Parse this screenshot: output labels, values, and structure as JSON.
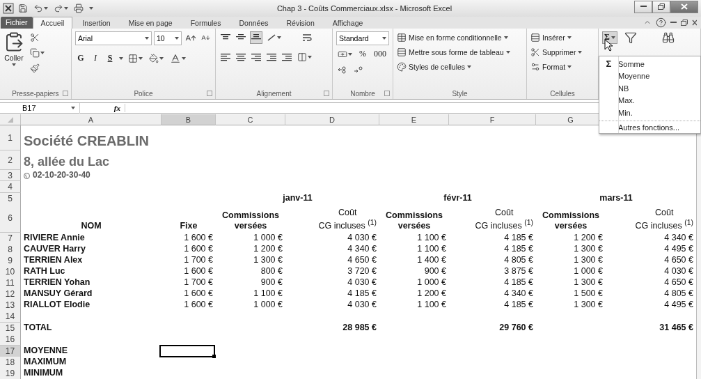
{
  "window": {
    "title": "Chap 3 - Coûts Commerciaux.xlsx - Microsoft Excel"
  },
  "ribbon": {
    "file_tab": "Fichier",
    "tabs": [
      {
        "label": "Accueil",
        "selected": true
      },
      {
        "label": "Insertion",
        "selected": false
      },
      {
        "label": "Mise en page",
        "selected": false
      },
      {
        "label": "Formules",
        "selected": false
      },
      {
        "label": "Données",
        "selected": false
      },
      {
        "label": "Révision",
        "selected": false
      },
      {
        "label": "Affichage",
        "selected": false
      }
    ],
    "groups": [
      {
        "kind": "clipboard",
        "label": "Presse-papiers",
        "launcher": true,
        "paste": "Coller"
      },
      {
        "kind": "font",
        "label": "Police",
        "launcher": true,
        "font": "Arial",
        "size": "10",
        "bold": "G",
        "italic": "I",
        "underline": "S"
      },
      {
        "kind": "alignment",
        "label": "Alignement",
        "launcher": true
      },
      {
        "kind": "number",
        "label": "Nombre",
        "launcher": true,
        "format": "Standard",
        "percent": "%",
        "thousands": "000"
      },
      {
        "kind": "style",
        "label": "Style",
        "items": [
          "Mise en forme conditionnelle",
          "Mettre sous forme de tableau",
          "Styles de cellules"
        ]
      },
      {
        "kind": "cells",
        "label": "Cellules",
        "items": [
          "Insérer",
          "Supprimer",
          "Format"
        ]
      },
      {
        "kind": "editing",
        "sum": "Σ",
        "pressed": true
      }
    ]
  },
  "formula_bar": {
    "name_box": "B17",
    "fx": "fx"
  },
  "sheet": {
    "columns": [
      {
        "label": "A",
        "selected": false
      },
      {
        "label": "B",
        "selected": true
      },
      {
        "label": "C",
        "selected": false
      },
      {
        "label": "D",
        "selected": false
      },
      {
        "label": "E",
        "selected": false
      },
      {
        "label": "F",
        "selected": false
      },
      {
        "label": "G",
        "selected": false
      }
    ],
    "rows": [
      {
        "header": "1",
        "selected": false,
        "kind": "company",
        "text": "Société CREABLIN"
      },
      {
        "header": "2",
        "selected": false,
        "kind": "address",
        "text": "8, allée du Lac"
      },
      {
        "header": "3",
        "selected": false,
        "kind": "phone",
        "text": "02-10-20-30-40"
      },
      {
        "header": "4",
        "selected": false,
        "kind": "blank"
      },
      {
        "header": "5",
        "selected": false,
        "kind": "months",
        "months": [
          "janv-11",
          "févr-11",
          "mars-11"
        ]
      },
      {
        "header": "6",
        "selected": false,
        "kind": "headings",
        "name": "NOM",
        "fixed": "Fixe",
        "groups": [
          {
            "commissions": "Commissions\nversées",
            "cost": "Coût\nCG incluses $^{(1)}$"
          },
          {
            "commissions": "Commissions\nversées",
            "cost": "Coût\nCG incluses $^{(1)}$"
          },
          {
            "commissions": "Commissions\nversées",
            "cost": "Coût\nCG incluses $^{(1)}$"
          }
        ]
      },
      {
        "header": "7",
        "selected": false,
        "kind": "person",
        "name": "RIVIERE Annie",
        "fixed": "1 600 €",
        "values": [
          "1 000 €",
          "4 030 €",
          "1 100 €",
          "4 185 €",
          "1 200 €",
          "4 340 €"
        ]
      },
      {
        "header": "8",
        "selected": false,
        "kind": "person",
        "name": "CAUVER Harry",
        "fixed": "1 600 €",
        "values": [
          "1 200 €",
          "4 340 €",
          "1 100 €",
          "4 185 €",
          "1 300 €",
          "4 495 €"
        ]
      },
      {
        "header": "9",
        "selected": false,
        "kind": "person",
        "name": "TERRIEN Alex",
        "fixed": "1 700 €",
        "values": [
          "1 300 €",
          "4 650 €",
          "1 400 €",
          "4 805 €",
          "1 300 €",
          "4 650 €"
        ]
      },
      {
        "header": "10",
        "selected": false,
        "kind": "person",
        "name": "RATH Luc",
        "fixed": "1 600 €",
        "values": [
          "800 €",
          "3 720 €",
          "900 €",
          "3 875 €",
          "1 000 €",
          "4 030 €"
        ]
      },
      {
        "header": "11",
        "selected": false,
        "kind": "person",
        "name": "TERRIEN Yohan",
        "fixed": "1 700 €",
        "values": [
          "900 €",
          "4 030 €",
          "1 000 €",
          "4 185 €",
          "1 300 €",
          "4 650 €"
        ]
      },
      {
        "header": "12",
        "selected": false,
        "kind": "person",
        "name": "MANSUY Gérard",
        "fixed": "1 600 €",
        "values": [
          "1 100 €",
          "4 185 €",
          "1 200 €",
          "4 340 €",
          "1 500 €",
          "4 805 €"
        ]
      },
      {
        "header": "13",
        "selected": false,
        "kind": "person",
        "name": "RIALLOT Elodie",
        "fixed": "1 600 €",
        "values": [
          "1 000 €",
          "4 030 €",
          "1 100 €",
          "4 185 €",
          "1 300 €",
          "4 495 €"
        ]
      },
      {
        "header": "14",
        "selected": false,
        "kind": "blank"
      },
      {
        "header": "15",
        "selected": false,
        "kind": "total",
        "text": "TOTAL",
        "totals": [
          "28 985 €",
          "29 760 €",
          "31 465 €"
        ]
      },
      {
        "header": "16",
        "selected": false,
        "kind": "blank"
      },
      {
        "header": "17",
        "selected": true,
        "kind": "label",
        "text": "MOYENNE"
      },
      {
        "header": "18",
        "selected": false,
        "kind": "label",
        "text": "MAXIMUM"
      },
      {
        "header": "19",
        "selected": false,
        "kind": "label",
        "text": "MINIMUM"
      }
    ]
  },
  "menu": {
    "items": [
      {
        "kind": "sum",
        "glyph": "Σ",
        "label": "Somme"
      },
      {
        "kind": "function",
        "label": "Moyenne"
      },
      {
        "kind": "function",
        "label": "NB"
      },
      {
        "kind": "function",
        "label": "Max."
      },
      {
        "kind": "function",
        "label": "Min."
      },
      {
        "kind": "more",
        "label": "Autres fonctions..."
      }
    ]
  }
}
